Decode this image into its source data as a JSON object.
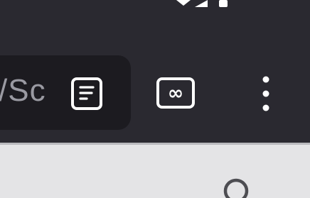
{
  "address_bar": {
    "url_fragment": "/Sc"
  },
  "toolbar": {
    "icons": {
      "reader": "reader-mode-icon",
      "tabs": "tab-switcher-icon",
      "menu": "more-options-icon"
    }
  },
  "status_bar": {
    "icons": [
      "signal-icon",
      "battery-icon"
    ]
  },
  "page": {
    "icons": [
      "search-icon"
    ]
  },
  "colors": {
    "toolbar_bg": "#2a2930",
    "address_bg": "#1c1b20",
    "icon_color": "#ffffff",
    "url_text_color": "#9a9aa2",
    "page_bg": "#e4e4e6"
  }
}
